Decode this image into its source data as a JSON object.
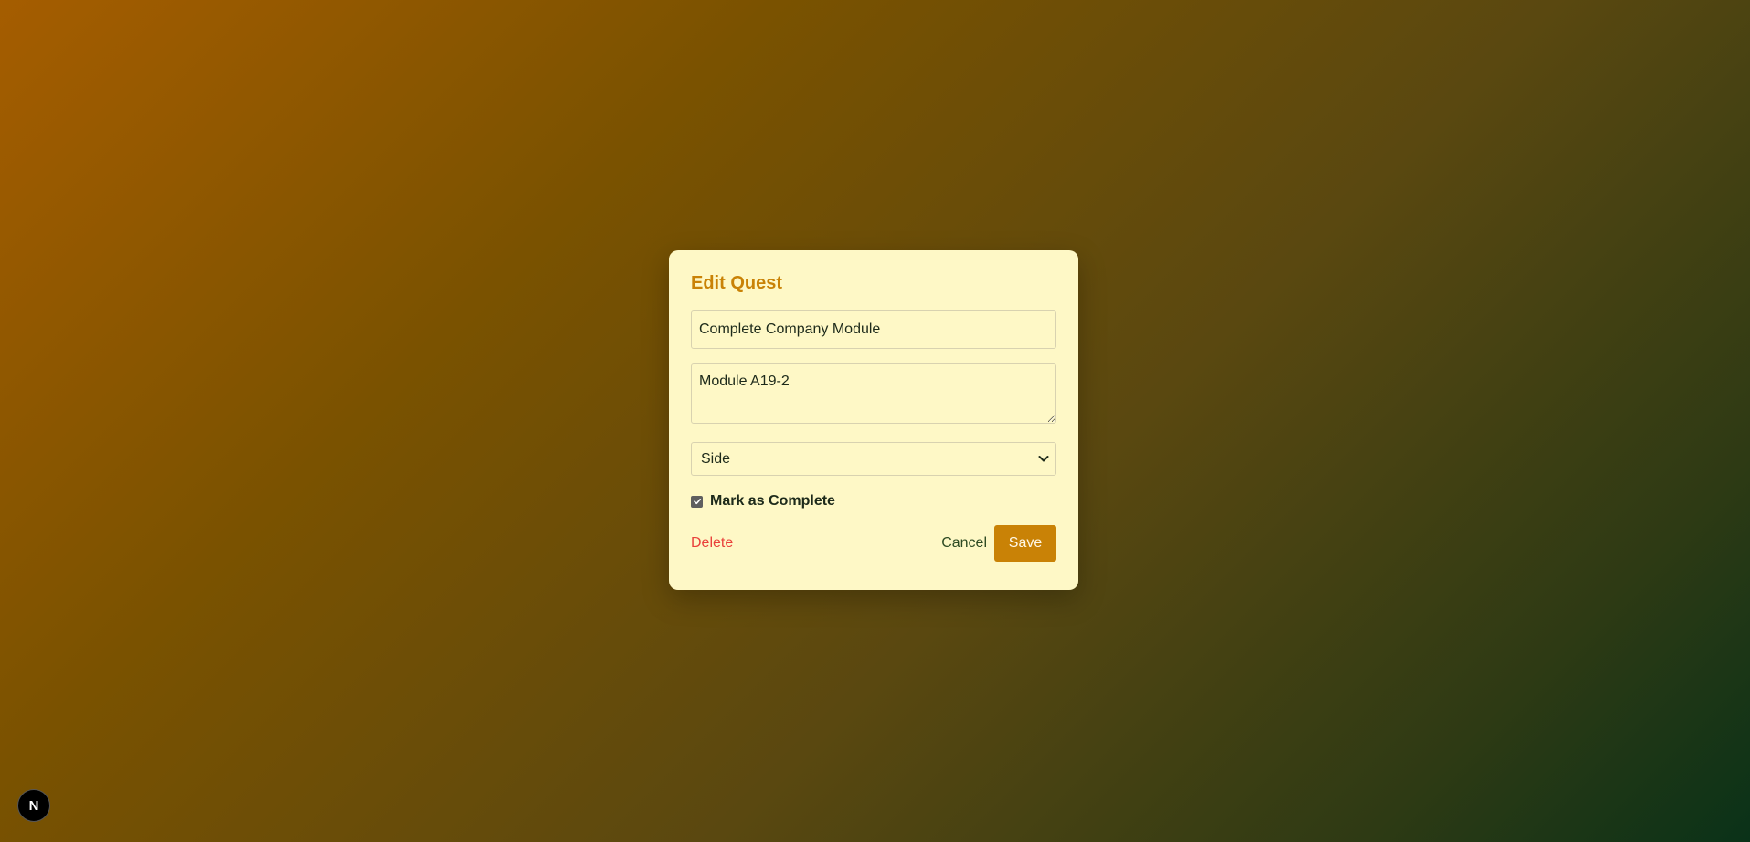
{
  "modal": {
    "title": "Edit Quest",
    "title_input_value": "Complete Company Module",
    "description_value": "Module A19-2",
    "type_select": {
      "selected": "Side",
      "options": [
        "Side"
      ]
    },
    "complete_checkbox": {
      "checked": true,
      "label": "Mark as Complete"
    },
    "delete_label": "Delete",
    "cancel_label": "Cancel",
    "save_label": "Save"
  },
  "badge": {
    "letter": "N"
  },
  "colors": {
    "accent": "#c98206",
    "modal_bg": "#fef8c6",
    "danger": "#e9403a",
    "text": "#1d2a1a"
  },
  "icons": {
    "select_chevron": "chevron-down-icon",
    "checkbox_mark": "checkmark-icon"
  }
}
